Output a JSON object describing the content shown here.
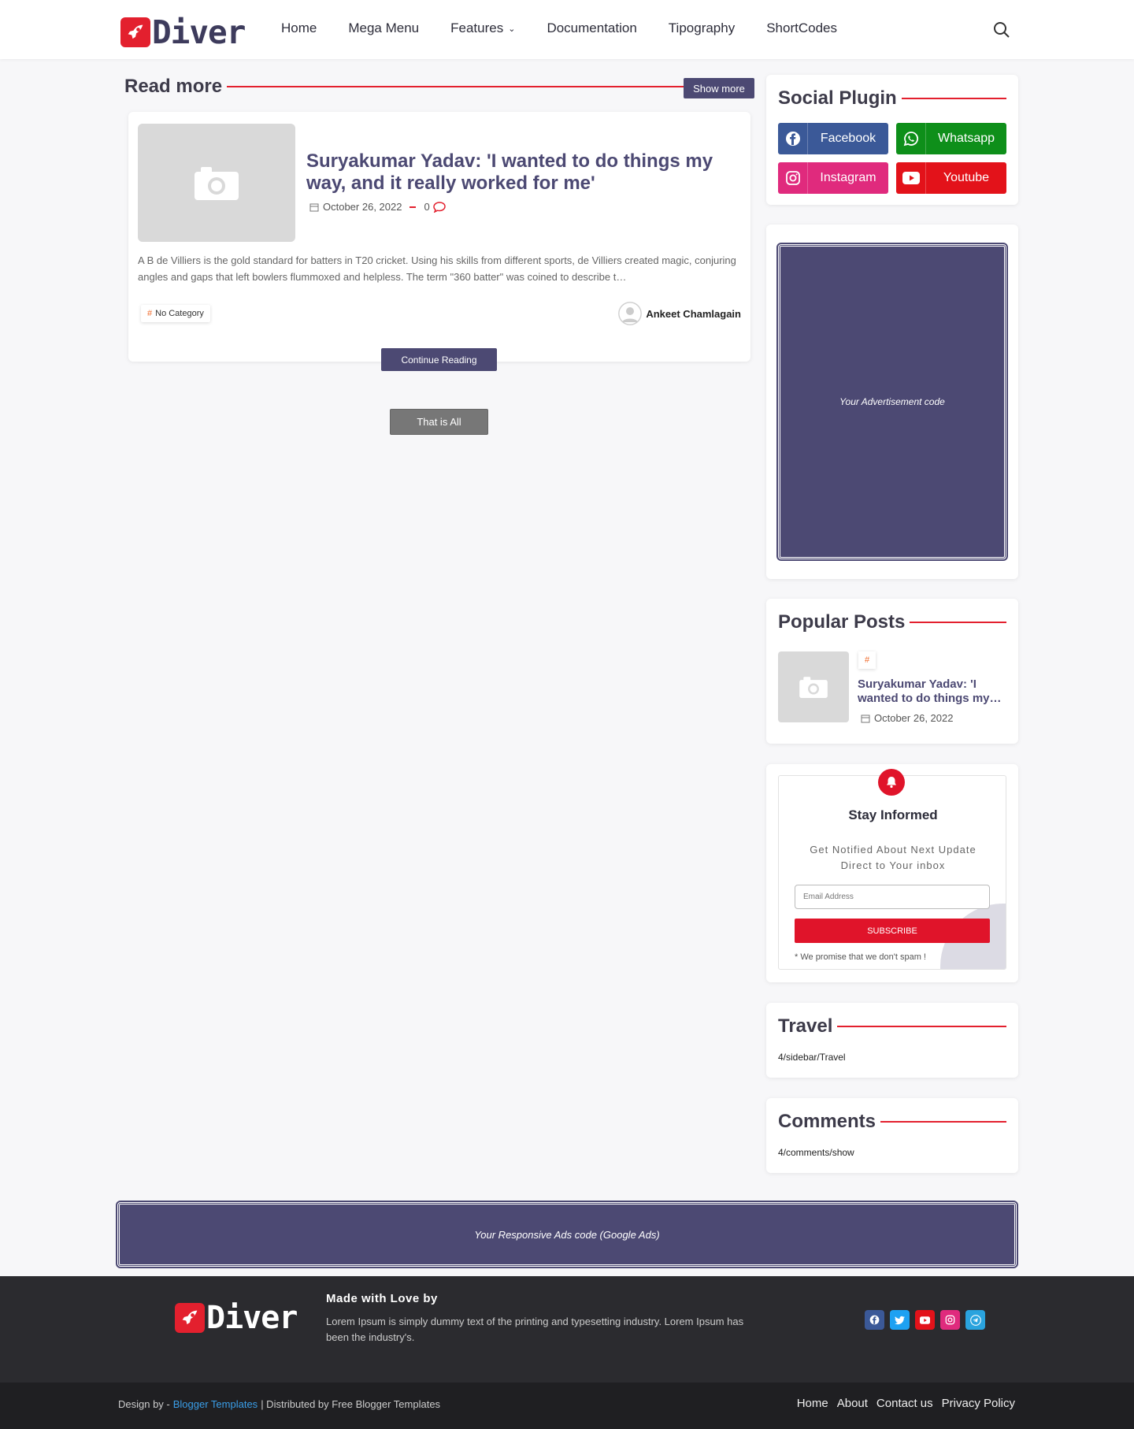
{
  "header": {
    "logo_text": "Diver",
    "nav": [
      {
        "label": "Home"
      },
      {
        "label": "Mega Menu"
      },
      {
        "label": "Features",
        "has_dropdown": true
      },
      {
        "label": "Documentation"
      },
      {
        "label": "Tipography"
      },
      {
        "label": "ShortCodes"
      }
    ],
    "search_icon": "search-icon"
  },
  "main": {
    "section_title": "Read more",
    "show_more_label": "Show more",
    "post": {
      "title": "Suryakumar Yadav: 'I wanted to do things my way, and it really worked for me'",
      "date": "October 26, 2022",
      "comments": "0",
      "excerpt": "A B de Villiers  is the gold standard for batters in T20 cricket. Using his skills from different sports, de Villiers created magic, conjuring angles and gaps that left bowlers flummoxed and helpless. The term \"360 batter\" was coined to describe t…",
      "category_hash": "#",
      "category": "No Category",
      "author": "Ankeet Chamlagain",
      "continue_label": "Continue Reading"
    },
    "thats_all_label": "That is All"
  },
  "sidebar": {
    "social": {
      "title": "Social Plugin",
      "buttons": [
        {
          "label": "Facebook",
          "color": "#3b5998",
          "icon": "facebook-icon"
        },
        {
          "label": "Whatsapp",
          "color": "#0e8f1a",
          "icon": "whatsapp-icon"
        },
        {
          "label": "Instagram",
          "color": "#e02a7d",
          "icon": "instagram-icon"
        },
        {
          "label": "Youtube",
          "color": "#e3121a",
          "icon": "youtube-icon"
        }
      ]
    },
    "ad_text": "Your Advertisement code",
    "popular": {
      "title": "Popular Posts",
      "tag": "#",
      "post_title": "Suryakumar Yadav: 'I wanted to do things my…",
      "date": "October 26, 2022"
    },
    "subscribe": {
      "title": "Stay Informed",
      "description": "Get Notified About Next Update Direct to Your inbox",
      "email_placeholder": "Email Address",
      "button_label": "SUBSCRIBE",
      "promise": "* We promise that we don't spam !"
    },
    "travel": {
      "title": "Travel",
      "text": "4/sidebar/Travel"
    },
    "comments": {
      "title": "Comments",
      "text": "4/comments/show"
    }
  },
  "bottom_ad_text": "Your Responsive Ads code (Google Ads)",
  "footer": {
    "logo_text": "Diver",
    "made_with": "Made with Love by",
    "description": "Lorem Ipsum is simply dummy text of the printing and typesetting industry. Lorem Ipsum has been the industry's.",
    "socials": [
      {
        "icon": "facebook-icon",
        "color": "#3b5998"
      },
      {
        "icon": "twitter-icon",
        "color": "#1da1f2"
      },
      {
        "icon": "youtube-icon",
        "color": "#e3121a"
      },
      {
        "icon": "instagram-icon",
        "color": "#e02a7d"
      },
      {
        "icon": "telegram-icon",
        "color": "#2aa3de"
      }
    ],
    "design_by": "Design by -",
    "design_link": "Blogger Templates",
    "distributed": "| Distributed by Free Blogger Templates",
    "links": [
      "Home",
      "About",
      "Contact us",
      "Privacy Policy"
    ]
  },
  "colors": {
    "accent": "#e3202e",
    "brand": "#4c4973"
  }
}
